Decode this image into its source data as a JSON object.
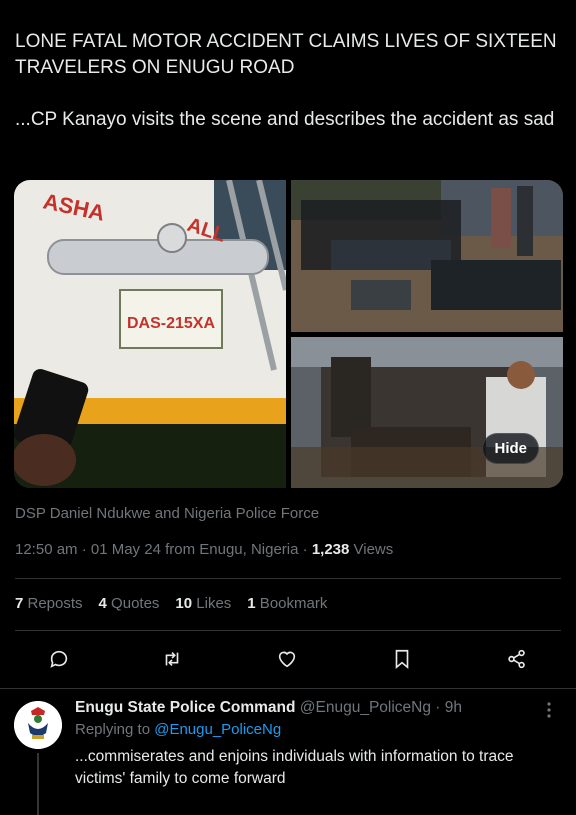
{
  "tweet": {
    "headline": "LONE FATAL MOTOR ACCIDENT CLAIMS LIVES OF SIXTEEN TRAVELERS ON ENUGU ROAD",
    "body": "...CP Kanayo visits the scene and describes the accident as sad"
  },
  "media": {
    "bus_text_1": "ASHA",
    "bus_text_2": "ALL",
    "plate": "DAS-215XA",
    "hide_label": "Hide"
  },
  "tagged": "DSP Daniel Ndukwe and Nigeria Police Force",
  "meta": {
    "time_place": "12:50 am · 01 May 24 from Enugu, Nigeria · ",
    "views_count": "1,238",
    "views_label": " Views"
  },
  "stats": [
    {
      "count": "7",
      "label": " Reposts"
    },
    {
      "count": "4",
      "label": " Quotes"
    },
    {
      "count": "10",
      "label": " Likes"
    },
    {
      "count": "1",
      "label": " Bookmark"
    }
  ],
  "actions": [
    "reply-icon",
    "repost-icon",
    "like-icon",
    "bookmark-icon",
    "share-icon"
  ],
  "reply": {
    "name": "Enugu State Police Command",
    "handle": " @Enugu_PoliceNg · 9h",
    "replying_prefix": "Replying to ",
    "replying_to": "@Enugu_PoliceNg",
    "text": "...commiserates and enjoins individuals with information to trace victims' family to come forward"
  },
  "colors": {
    "background": "#000000",
    "text": "#e7e9ea",
    "muted": "#71767b",
    "link": "#1d9bf0",
    "border": "#2f3336"
  }
}
